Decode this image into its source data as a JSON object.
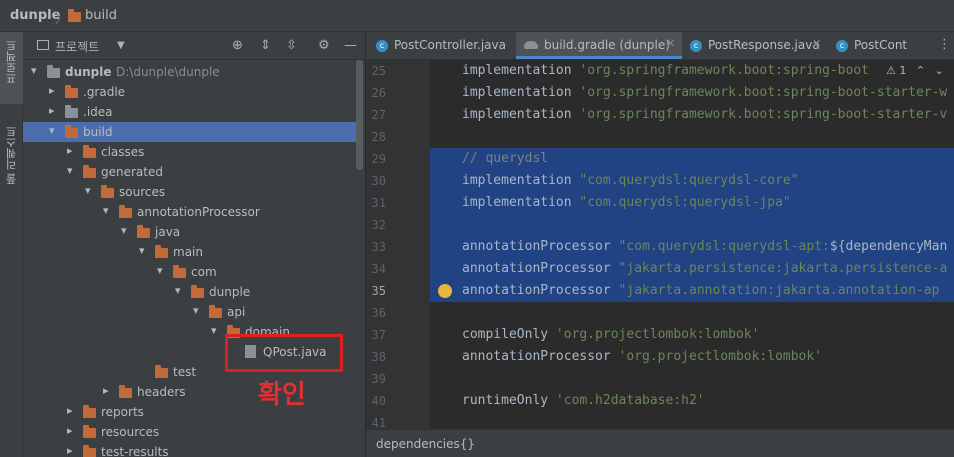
{
  "breadcrumb": {
    "root": "dunple",
    "child": "build"
  },
  "left_stripe": {
    "project_label": "프로젝트",
    "commit_label": "풀 리퀘스트"
  },
  "project_panel": {
    "title": "프로젝트",
    "tree": [
      {
        "label": "dunple",
        "path": "D:\\dunple\\dunple",
        "arrow": "▾",
        "depth": 0,
        "kind": "folder-grey"
      },
      {
        "label": ".gradle",
        "arrow": "▸",
        "depth": 1,
        "kind": "folder"
      },
      {
        "label": ".idea",
        "arrow": "▸",
        "depth": 1,
        "kind": "folder-grey"
      },
      {
        "label": "build",
        "arrow": "▾",
        "depth": 1,
        "kind": "folder",
        "selected": true
      },
      {
        "label": "classes",
        "arrow": "▸",
        "depth": 2,
        "kind": "folder"
      },
      {
        "label": "generated",
        "arrow": "▾",
        "depth": 2,
        "kind": "folder"
      },
      {
        "label": "sources",
        "arrow": "▾",
        "depth": 3,
        "kind": "folder"
      },
      {
        "label": "annotationProcessor",
        "arrow": "▾",
        "depth": 4,
        "kind": "folder"
      },
      {
        "label": "java",
        "arrow": "▾",
        "depth": 5,
        "kind": "folder"
      },
      {
        "label": "main",
        "arrow": "▾",
        "depth": 6,
        "kind": "folder"
      },
      {
        "label": "com",
        "arrow": "▾",
        "depth": 7,
        "kind": "folder"
      },
      {
        "label": "dunple",
        "arrow": "▾",
        "depth": 8,
        "kind": "folder"
      },
      {
        "label": "api",
        "arrow": "▾",
        "depth": 9,
        "kind": "folder"
      },
      {
        "label": "domain",
        "arrow": "▾",
        "depth": 10,
        "kind": "folder"
      },
      {
        "label": "QPost.java",
        "arrow": "",
        "depth": 11,
        "kind": "java"
      },
      {
        "label": "test",
        "arrow": "",
        "depth": 6,
        "kind": "folder"
      },
      {
        "label": "headers",
        "arrow": "▸",
        "depth": 4,
        "kind": "folder"
      },
      {
        "label": "reports",
        "arrow": "▸",
        "depth": 2,
        "kind": "folder"
      },
      {
        "label": "resources",
        "arrow": "▸",
        "depth": 2,
        "kind": "folder"
      },
      {
        "label": "test-results",
        "arrow": "▸",
        "depth": 2,
        "kind": "folder"
      }
    ]
  },
  "annotation": {
    "text": "확인",
    "color": "#e02020"
  },
  "tabs": [
    {
      "label": "PostController.java",
      "icon": "class-icon",
      "active": false
    },
    {
      "label": "build.gradle (dunple)",
      "icon": "gradle-icon",
      "active": true
    },
    {
      "label": "PostResponse.java",
      "icon": "class-icon",
      "active": false
    },
    {
      "label": "PostCont",
      "icon": "class-icon",
      "active": false
    }
  ],
  "editor": {
    "warning_count": "1",
    "current_line": "35",
    "lines": [
      {
        "n": "25",
        "parts": [
          [
            "kw",
            "implementation "
          ],
          [
            "str",
            "'org.springframework.boot:spring-boot"
          ]
        ]
      },
      {
        "n": "26",
        "parts": [
          [
            "kw",
            "implementation "
          ],
          [
            "str",
            "'org.springframework.boot:spring-boot-starter-w"
          ]
        ]
      },
      {
        "n": "27",
        "parts": [
          [
            "kw",
            "implementation "
          ],
          [
            "str",
            "'org.springframework.boot:spring-boot-starter-v"
          ]
        ]
      },
      {
        "n": "28",
        "parts": []
      },
      {
        "n": "29",
        "parts": [
          [
            "cmt",
            "// querydsl"
          ]
        ],
        "sel": true
      },
      {
        "n": "30",
        "parts": [
          [
            "kw",
            "implementation "
          ],
          [
            "str",
            "\"com.querydsl:querydsl-core\""
          ]
        ],
        "sel": true
      },
      {
        "n": "31",
        "parts": [
          [
            "kw",
            "implementation "
          ],
          [
            "str",
            "\"com.querydsl:querydsl-jpa\""
          ]
        ],
        "sel": true
      },
      {
        "n": "32",
        "parts": [],
        "sel": true
      },
      {
        "n": "33",
        "parts": [
          [
            "kw",
            "annotationProcessor "
          ],
          [
            "str",
            "\"com.querydsl:querydsl-apt:"
          ],
          [
            "kw",
            "${dependencyMan"
          ]
        ],
        "sel": true
      },
      {
        "n": "34",
        "parts": [
          [
            "kw",
            "annotationProcessor "
          ],
          [
            "str",
            "\"jakarta.persistence:jakarta.persistence-a"
          ]
        ],
        "sel": true
      },
      {
        "n": "35",
        "parts": [
          [
            "kw",
            "annotationProcessor "
          ],
          [
            "str",
            "\"jakarta.annotation:jakarta.annotation-ap"
          ]
        ],
        "sel": true
      },
      {
        "n": "36",
        "parts": []
      },
      {
        "n": "37",
        "parts": [
          [
            "kw",
            "compileOnly "
          ],
          [
            "str",
            "'org.projectlombok:lombok'"
          ]
        ]
      },
      {
        "n": "38",
        "parts": [
          [
            "kw",
            "annotationProcessor "
          ],
          [
            "str",
            "'org.projectlombok:lombok'"
          ]
        ]
      },
      {
        "n": "39",
        "parts": []
      },
      {
        "n": "40",
        "parts": [
          [
            "kw",
            "runtimeOnly "
          ],
          [
            "str",
            "'com.h2database:h2'"
          ]
        ]
      },
      {
        "n": "41",
        "parts": []
      }
    ]
  },
  "status_bar": {
    "text": "dependencies{}"
  }
}
